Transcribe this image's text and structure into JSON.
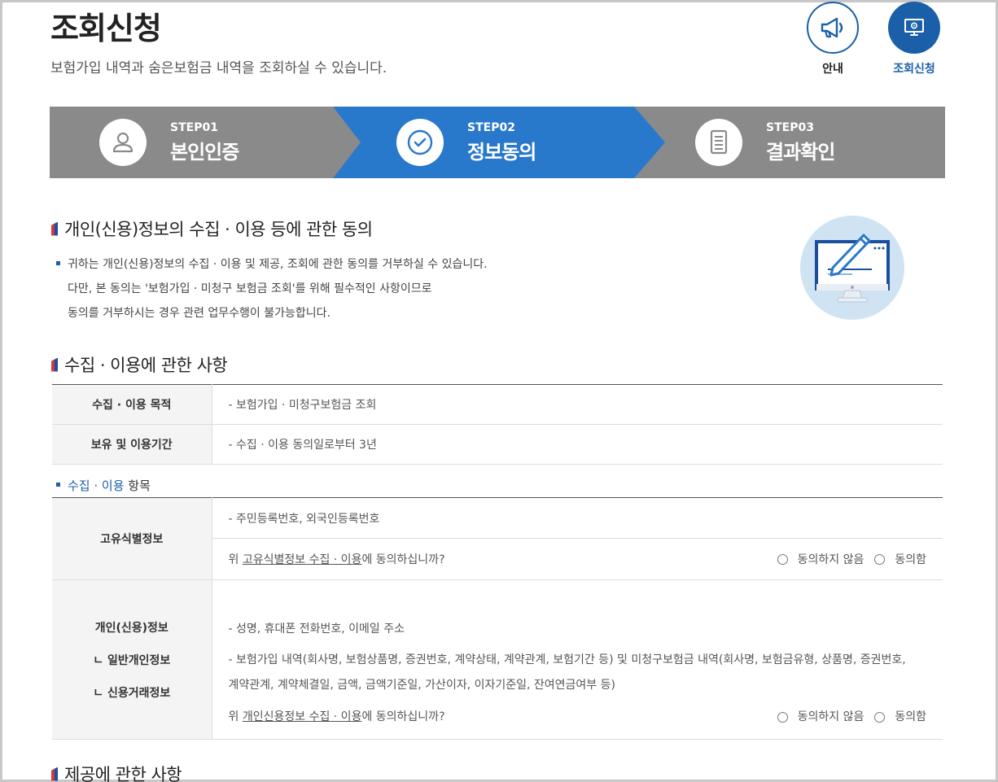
{
  "page": {
    "title": "조회신청",
    "subtitle": "보험가입 내역과 숨은보험금 내역을 조회하실 수 있습니다."
  },
  "top_nav": [
    {
      "label": "안내",
      "icon": "megaphone-icon"
    },
    {
      "label": "조회신청",
      "icon": "monitor-icon",
      "active": true
    }
  ],
  "steps": [
    {
      "no": "STEP01",
      "name": "본인인증",
      "icon": "person-icon"
    },
    {
      "no": "STEP02",
      "name": "정보동의",
      "icon": "check-circle-icon",
      "active": true
    },
    {
      "no": "STEP03",
      "name": "결과확인",
      "icon": "document-icon"
    }
  ],
  "section1": {
    "title": "개인(신용)정보의 수집 · 이용 등에 관한 동의",
    "notice_line1": "귀하는 개인(신용)정보의 수집 · 이용 및 제공, 조회에 관한 동의를 거부하실 수 있습니다.",
    "notice_line2": "다만, 본 동의는 '보험가입 · 미청구 보험금 조회'를 위해 필수적인 사항이므로",
    "notice_line3": "동의를 거부하시는 경우 관련 업무수행이 불가능합니다."
  },
  "section2": {
    "title": "수집 · 이용에 관한 사항",
    "rows": [
      {
        "header": "수집 · 이용 목적",
        "value": "- 보험가입 · 미청구보험금 조회"
      },
      {
        "header": "보유 및 이용기간",
        "value": "- 수집 · 이용 동의일로부터 3년"
      }
    ],
    "items_label_blue": "수집 · 이용",
    "items_label_rest": " 항목",
    "unique": {
      "header": "고유식별정보",
      "value": "- 주민등록번호, 외국인등록번호",
      "q_prefix": "위 ",
      "q_link": "고유식별정보 수집 · 이용",
      "q_suffix": "에 동의하십니까?",
      "opt_no": "동의하지 않음",
      "opt_yes": "동의함"
    },
    "personal": {
      "header_main": "개인(신용)정보",
      "header_sub1": "ㄴ 일반개인정보",
      "header_sub2": "ㄴ 신용거래정보",
      "general": "- 성명, 휴대폰 전화번호, 이메일 주소",
      "credit_line1": "- 보험가입 내역(회사명, 보험상품명, 증권번호, 계약상태, 계약관계, 보험기간 등) 및 미청구보험금 내역(회사명, 보험금유형, 상품명, 증권번호,",
      "credit_line2": "계약관계, 계약체결일, 금액, 금액기준일, 가산이자, 이자기준일, 잔여연금여부 등)",
      "q_prefix": "위 ",
      "q_link": "개인신용정보 수집 · 이용",
      "q_suffix": "에 동의하십니까?",
      "opt_no": "동의하지 않음",
      "opt_yes": "동의함"
    }
  },
  "section3": {
    "title": "제공에 관한 사항"
  },
  "colors": {
    "primary": "#1a5fa8",
    "step_active": "#2878cc",
    "step_inactive": "#8a8a8a"
  }
}
